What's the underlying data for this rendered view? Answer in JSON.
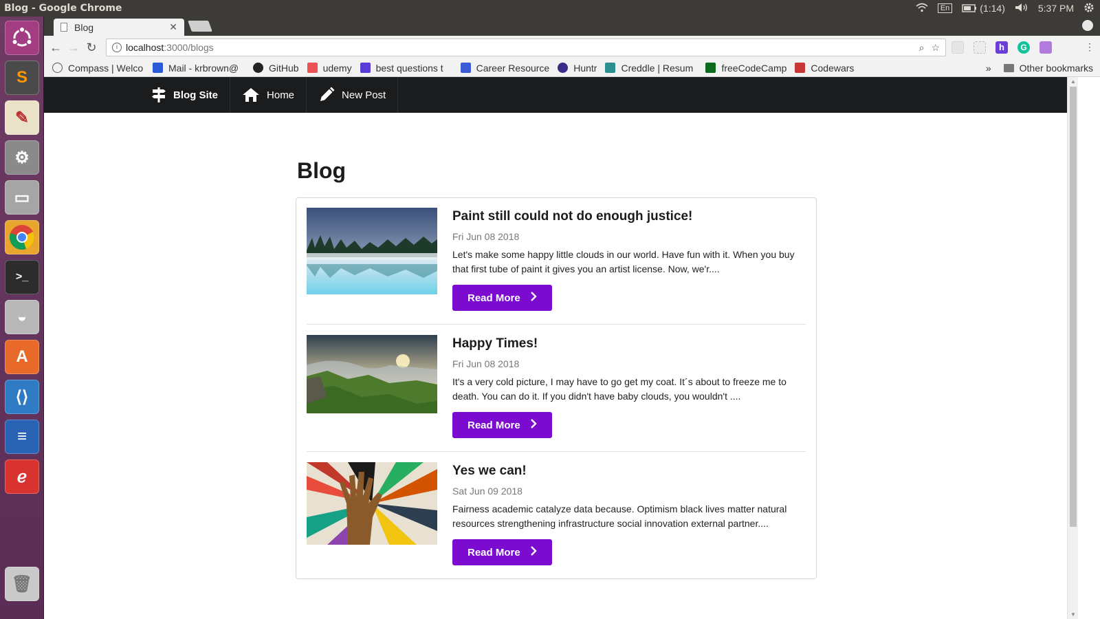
{
  "os": {
    "window_title": "Blog - Google Chrome",
    "keyboard": "En",
    "battery": "(1:14)",
    "time": "5:37 PM"
  },
  "browser": {
    "tab_title": "Blog",
    "url_host": "localhost",
    "url_path": ":3000/blogs",
    "bookmarks": [
      {
        "label": "Compass | Welco",
        "color": "#555555"
      },
      {
        "label": "Mail - krbrown@",
        "color": "#2a5bd7"
      },
      {
        "label": "GitHub",
        "color": "#222222"
      },
      {
        "label": "udemy",
        "color": "#ec5252"
      },
      {
        "label": "best questions t",
        "color": "#5b3bd7"
      },
      {
        "label": "Career Resource",
        "color": "#3b5bd7"
      },
      {
        "label": "Huntr",
        "color": "#3a2a8a"
      },
      {
        "label": "Creddle | Resum",
        "color": "#2b8f8f"
      },
      {
        "label": "freeCodeCamp",
        "color": "#0a6b1e"
      },
      {
        "label": "Codewars",
        "color": "#c83737"
      }
    ],
    "bookmarks_more": "»",
    "other_bookmarks": "Other bookmarks"
  },
  "site": {
    "brand": "Blog Site",
    "nav": [
      "Home",
      "New Post"
    ],
    "page_title": "Blog",
    "accent_color": "#7a0bcf",
    "posts": [
      {
        "title": "Paint still could not do enough justice!",
        "date": "Fri Jun 08 2018",
        "excerpt": "Let's make some happy little clouds in our world. Have fun with it. When you buy that first tube of paint it gives you an artist license. Now, we'r....",
        "button": "Read More",
        "image": "misty-lake-forest"
      },
      {
        "title": "Happy Times!",
        "date": "Fri Jun 08 2018",
        "excerpt": "It's a very cold picture, I may have to go get my coat. It´s about to freeze me to death. You can do it. If you didn't have baby clouds, you wouldn't ....",
        "button": "Read More",
        "image": "green-cliffs-sunset"
      },
      {
        "title": "Yes we can!",
        "date": "Sat Jun 09 2018",
        "excerpt": "Fairness academic catalyze data because. Optimism black lives matter natural resources strengthening infrastructure social innovation external partner....",
        "button": "Read More",
        "image": "justice-collage-hand"
      }
    ]
  }
}
